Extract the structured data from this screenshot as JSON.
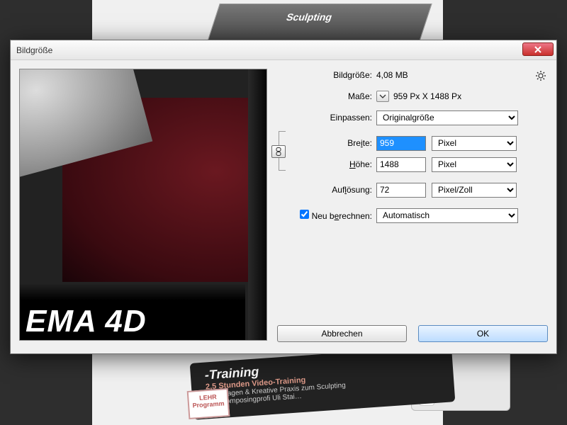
{
  "bg": {
    "box1_text": "Sculpting",
    "training_title": "-Training",
    "training_line1": "2,5 Stunden Video-Training",
    "training_line2": "Grundlagen & Kreative Praxis zum Sculpting",
    "training_line3": "Von Composingprofi Uli Stai…",
    "badge_l1": "LEHR",
    "badge_l2": "Programm"
  },
  "dialog": {
    "title": "Bildgröße",
    "filesize_label": "Bildgröße:",
    "filesize_value": "4,08 MB",
    "dims_label": "Maße:",
    "dims_value": "959 Px  X  1488 Px",
    "fit_label": "Einpassen:",
    "fit_value": "Originalgröße",
    "width_label_pre": "Bre",
    "width_label_mn": "i",
    "width_label_post": "te:",
    "width_value": "959",
    "width_unit": "Pixel",
    "height_label_pre": "",
    "height_label_mn": "H",
    "height_label_post": "öhe:",
    "height_value": "1488",
    "height_unit": "Pixel",
    "res_label_pre": "Auf",
    "res_label_mn": "l",
    "res_label_post": "ösung:",
    "res_value": "72",
    "res_unit": "Pixel/Zoll",
    "resample_label_pre": "Neu b",
    "resample_label_mn": "e",
    "resample_label_post": "rechnen:",
    "resample_value": "Automatisch",
    "cancel": "Abbrechen",
    "ok": "OK",
    "preview_logo": "EMA 4D"
  }
}
